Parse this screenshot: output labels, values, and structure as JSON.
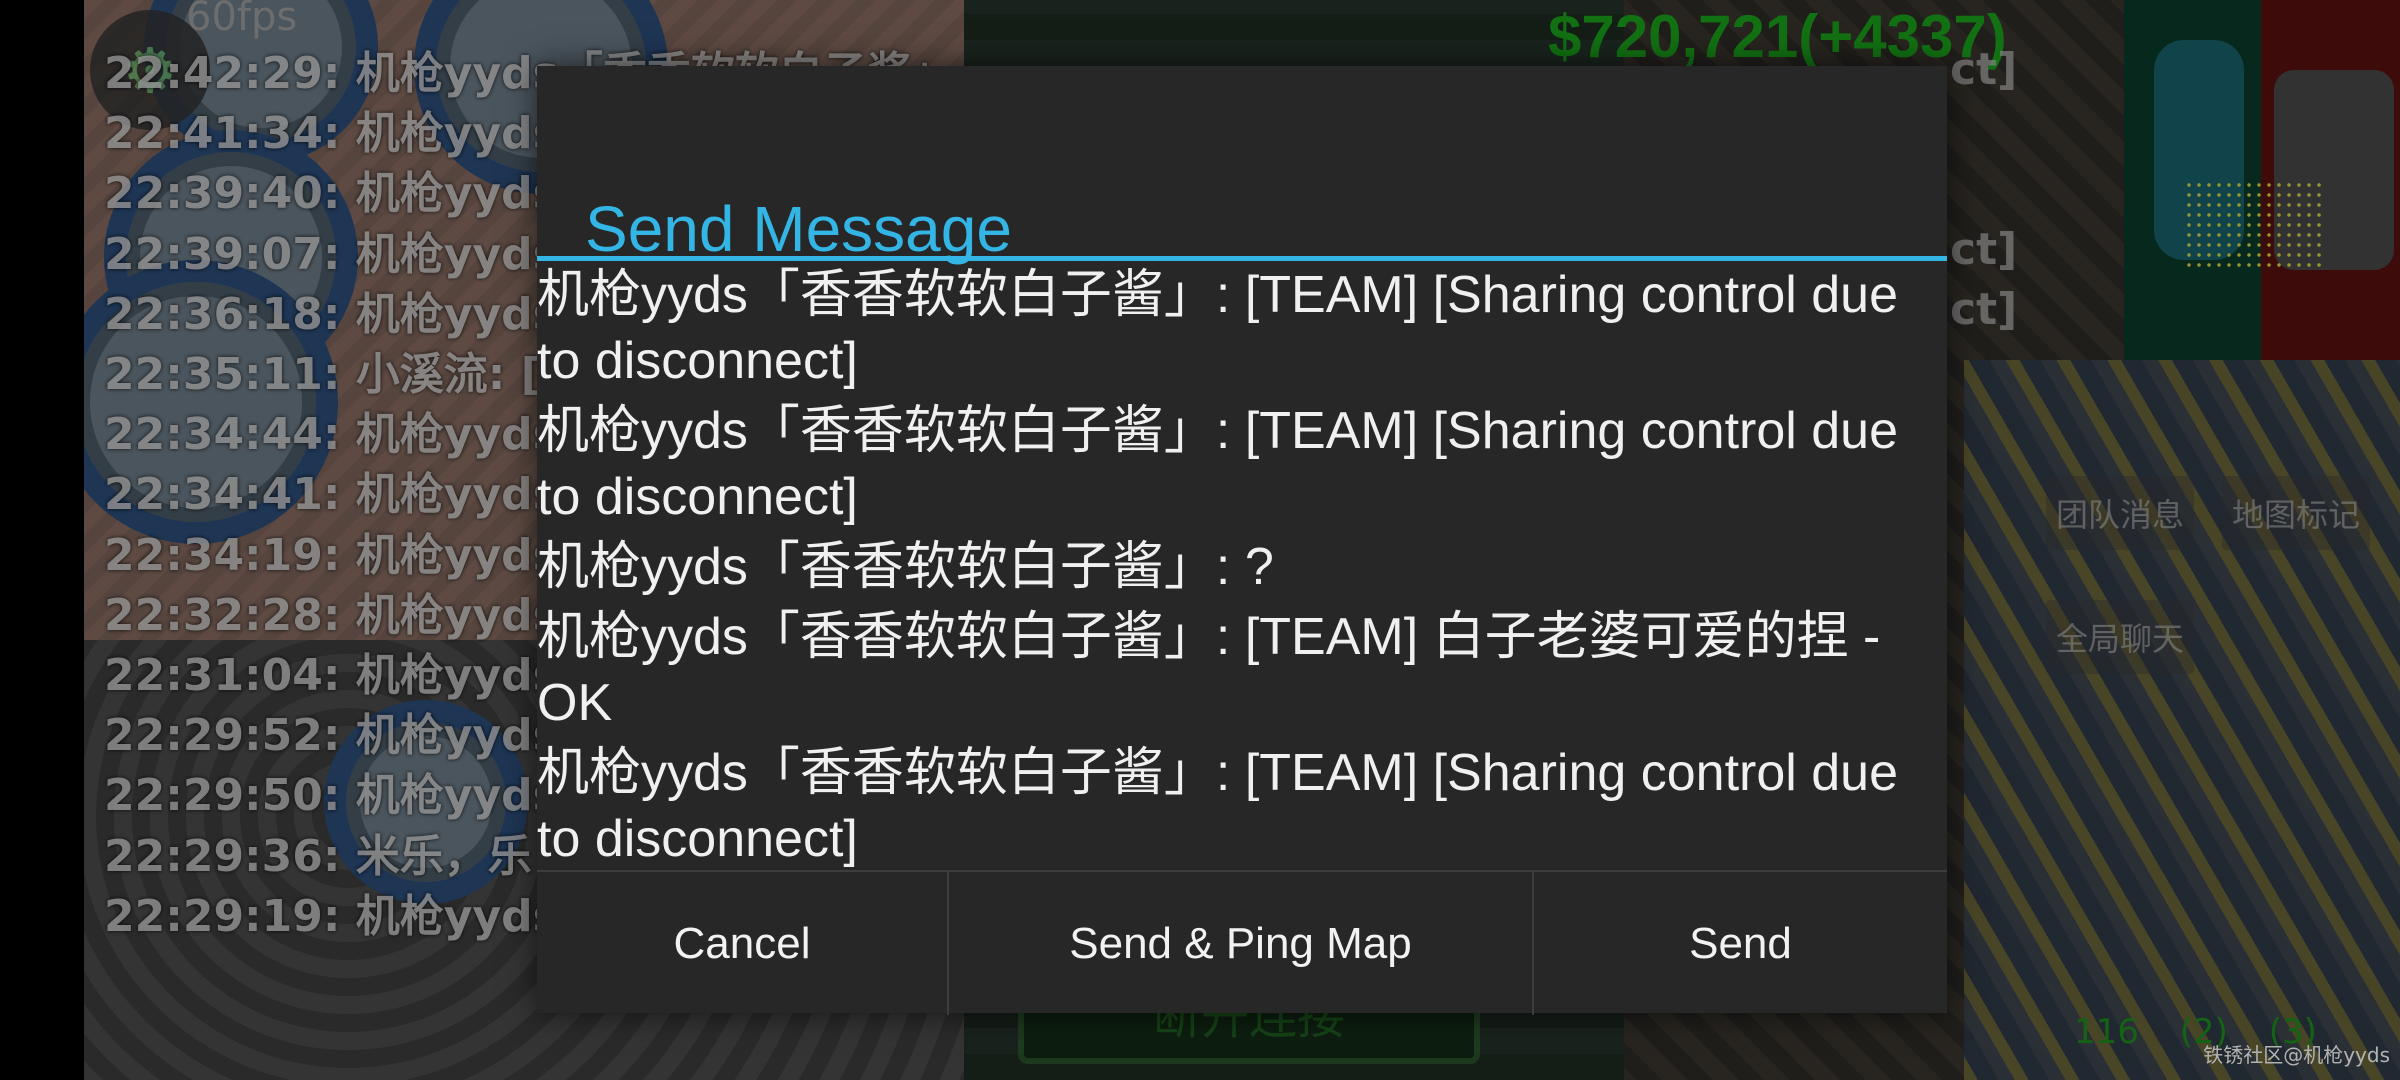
{
  "hud": {
    "fps": "60fps",
    "money": "$720,721(+4337)",
    "settings_icon": "gear-icon",
    "team_messages": "团队消息",
    "map_markers": "地图标记",
    "global_chat": "全局聊天",
    "unit_counts": [
      "116",
      "(2)",
      "(3)"
    ],
    "disconnect_label": "断开连接",
    "watermark": "铁锈社区@机枪yyds"
  },
  "chat_log": [
    "22:42:29: 机枪yyds「香香软软白子酱」",
    "22:41:34: 机枪yyds",
    "22:39:40: 机枪yyds",
    "22:39:07: 机枪yyds",
    "22:36:18: 机枪yyds",
    "22:35:11: 小溪流: [",
    "22:34:44: 机枪yyds",
    "22:34:41: 机枪yyds",
    "22:34:19: 机枪yyds",
    "22:32:28: 机枪yyds",
    "22:31:04: 机枪yyds",
    "22:29:52: 机枪yyds",
    "22:29:50: 机枪yyds",
    "22:29:36: 米乐，乐",
    "22:29:19: 机枪yyds"
  ],
  "chat_right_fragments": [
    "ct]",
    "ct]",
    "ct]"
  ],
  "dialog": {
    "title": "Send Message",
    "messages": [
      "机枪yyds「香香软软白子酱」: [TEAM]  [Sharing control due to disconnect]",
      "机枪yyds「香香软软白子酱」: [TEAM]  [Sharing control due to disconnect]",
      "机枪yyds「香香软软白子酱」: ?",
      "机枪yyds「香香软软白子酱」: [TEAM]  白子老婆可爱的捏 - OK",
      "机枪yyds「香香软软白子酱」: [TEAM]  [Sharing control due to disconnect]"
    ],
    "buttons": {
      "cancel": "Cancel",
      "send_ping": "Send & Ping Map",
      "send": "Send"
    }
  },
  "colors": {
    "accent": "#33b5e5",
    "dialog_bg": "#272727",
    "money": "#1aa21a"
  }
}
